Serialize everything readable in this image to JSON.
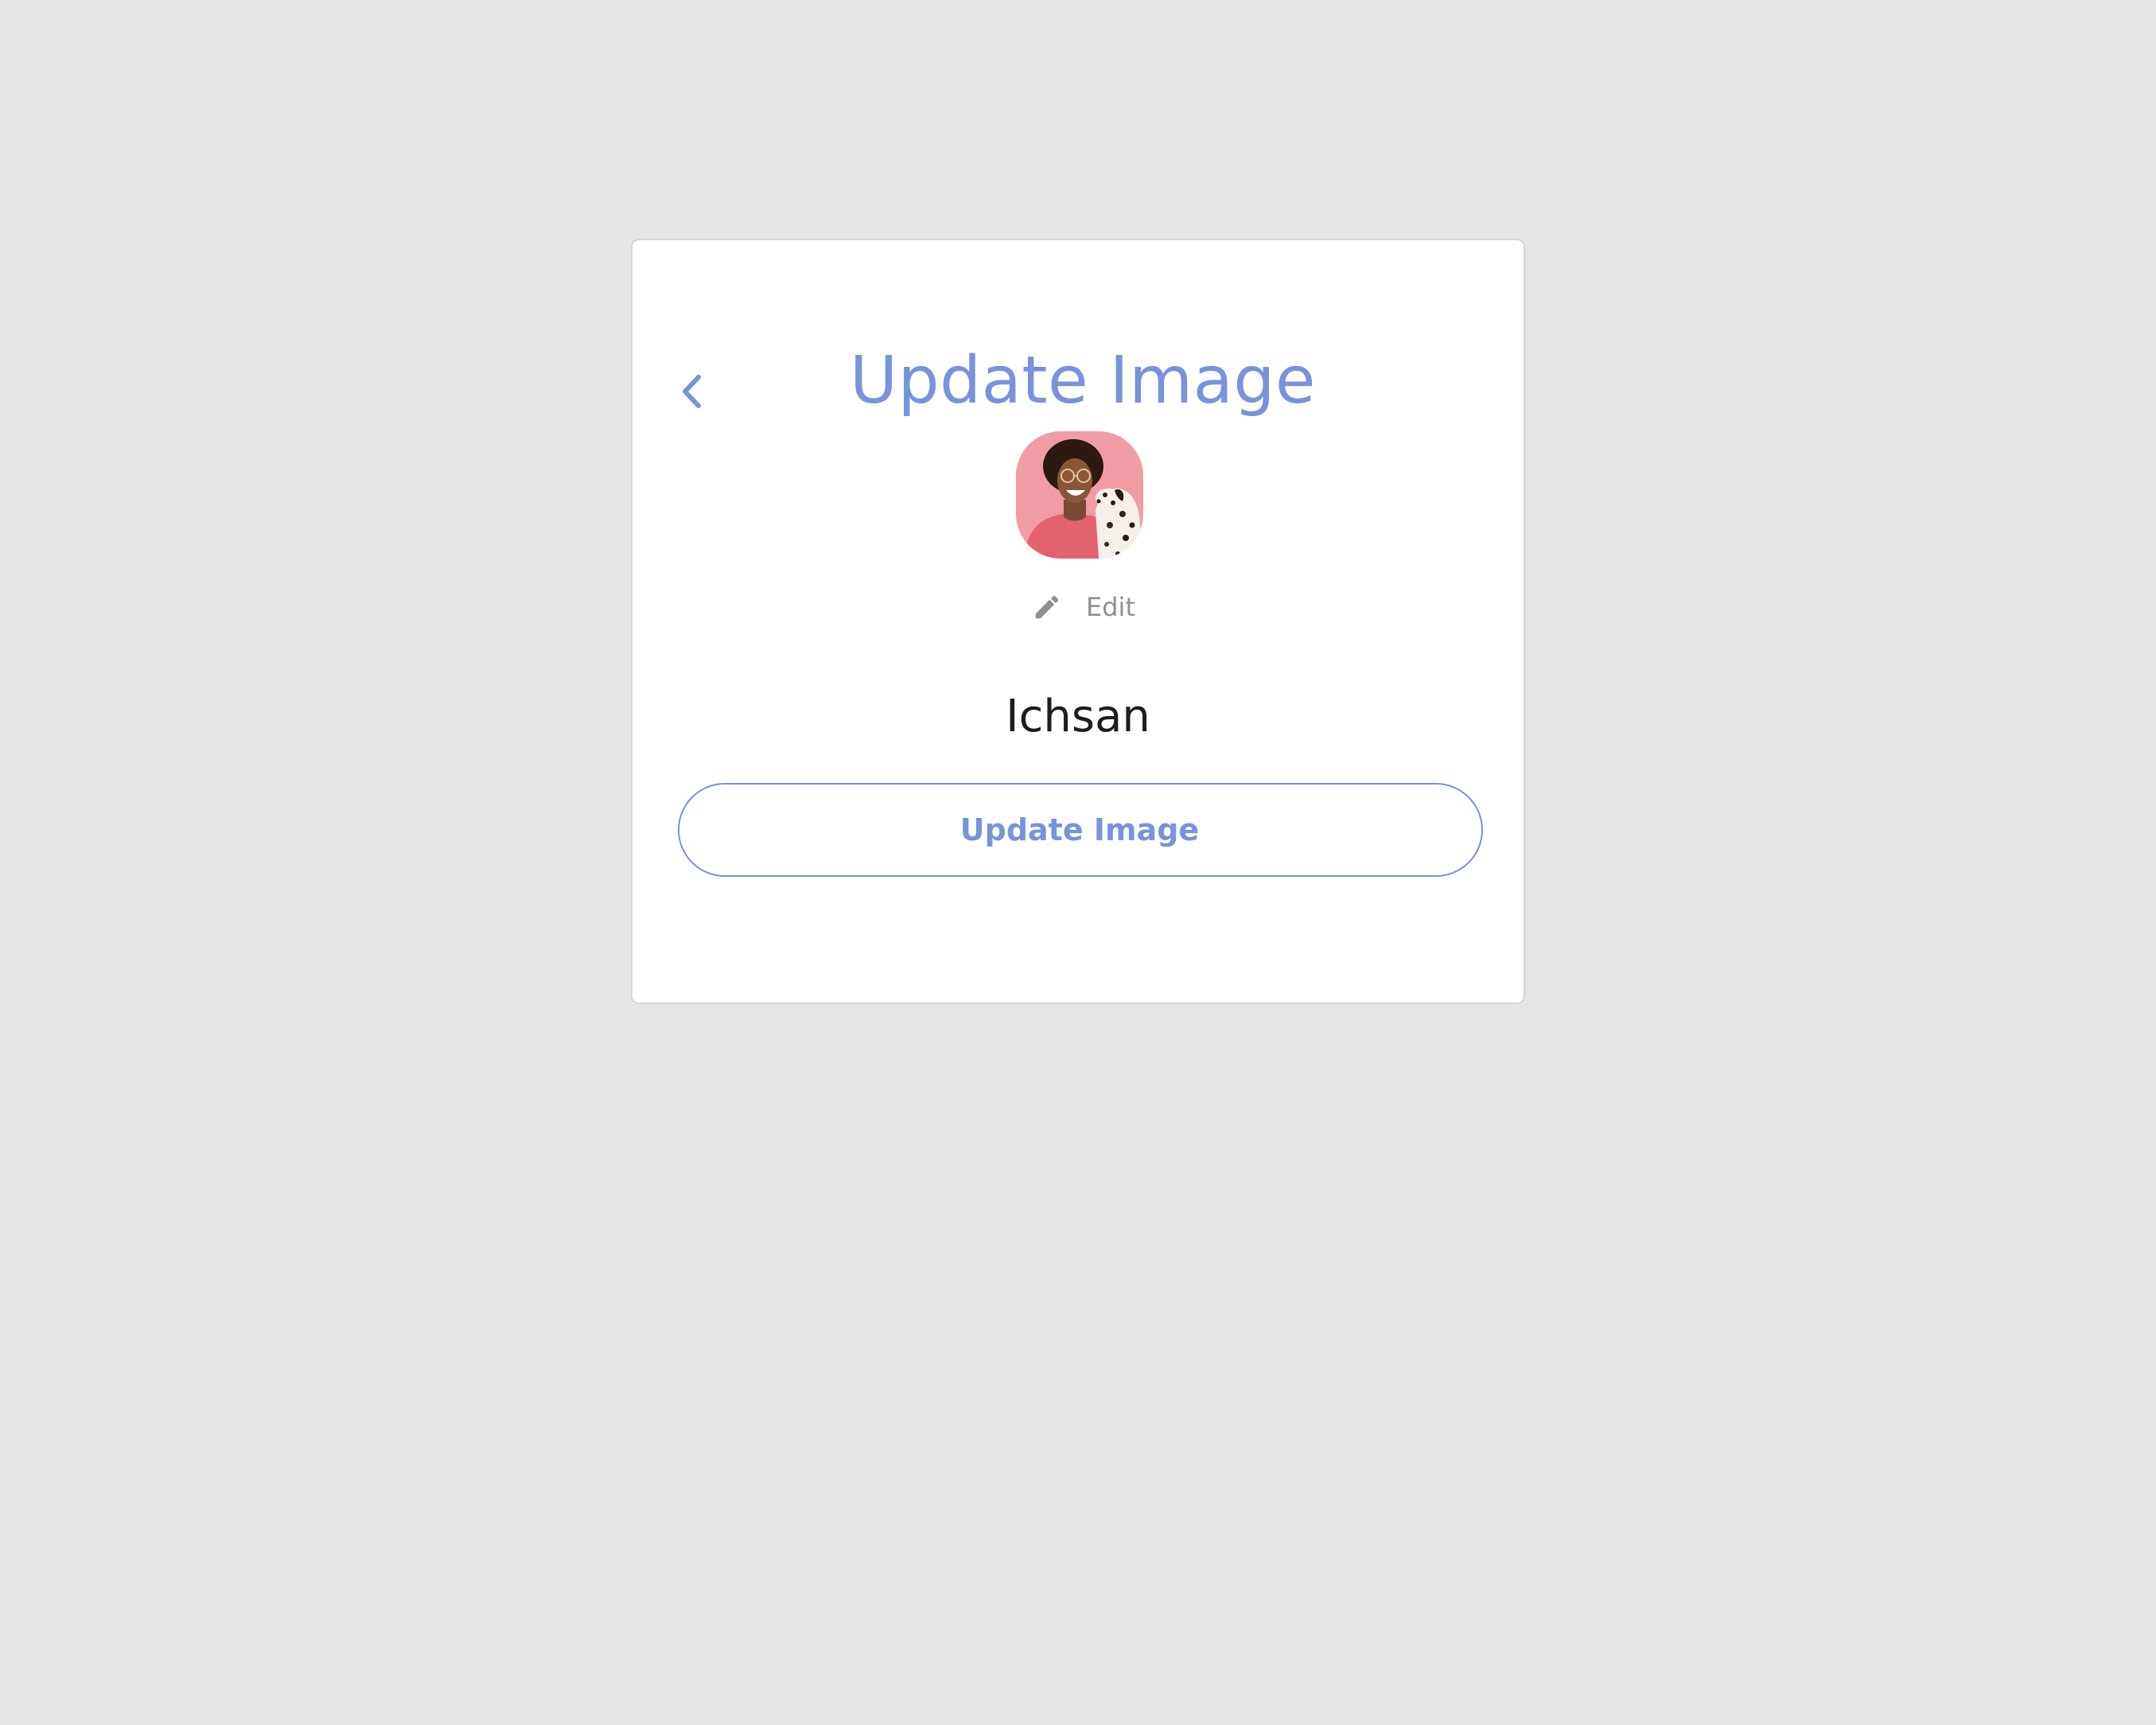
{
  "header": {
    "title": "Update Image",
    "back_icon": "chevron-left-icon"
  },
  "profile": {
    "avatar_alt": "profile photo",
    "edit_icon": "pencil-icon",
    "edit_label": "Edit",
    "name": "Ichsan"
  },
  "actions": {
    "update_label": "Update Image"
  },
  "colors": {
    "accent": "#7893dc",
    "background": "#e5e5e5",
    "card": "#ffffff",
    "avatar_background": "#f19ca4"
  }
}
